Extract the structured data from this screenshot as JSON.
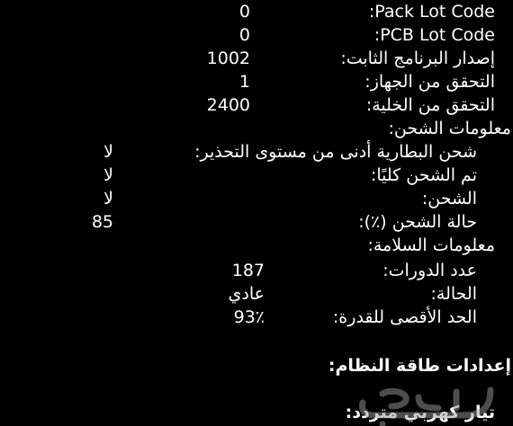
{
  "rows": [
    {
      "label": "Pack Lot Code:",
      "value": "0"
    },
    {
      "label": "PCB Lot Code:",
      "value": "0"
    },
    {
      "label": "إصدار البرنامج الثابت:",
      "value": "1002"
    },
    {
      "label": "التحقق من الجهاز:",
      "value": "1"
    },
    {
      "label": "التحقق من الخلية:",
      "value": "2400"
    }
  ],
  "charge_info": {
    "heading": "معلومات الشحن:",
    "rows": [
      {
        "label": "شحن البطارية أدنى من مستوى التحذير:",
        "value": "لا"
      },
      {
        "label": "تم الشحن كليًا:",
        "value": "لا"
      },
      {
        "label": "الشحن:",
        "value": "لا"
      },
      {
        "label": "حالة الشحن (٪):",
        "value": "85"
      }
    ]
  },
  "health_info": {
    "heading": "معلومات السلامة:",
    "rows": [
      {
        "label": "عدد الدورات:",
        "value": "187"
      },
      {
        "label": "الحالة:",
        "value": "عادي"
      },
      {
        "label": "الحد الأقصى للقدرة:",
        "value": "93٪"
      }
    ]
  },
  "power_settings": {
    "heading": "إعدادات طاقة النظام:",
    "ac_label": "تيار كهربي متردد:"
  },
  "watermark_text": "حراج"
}
